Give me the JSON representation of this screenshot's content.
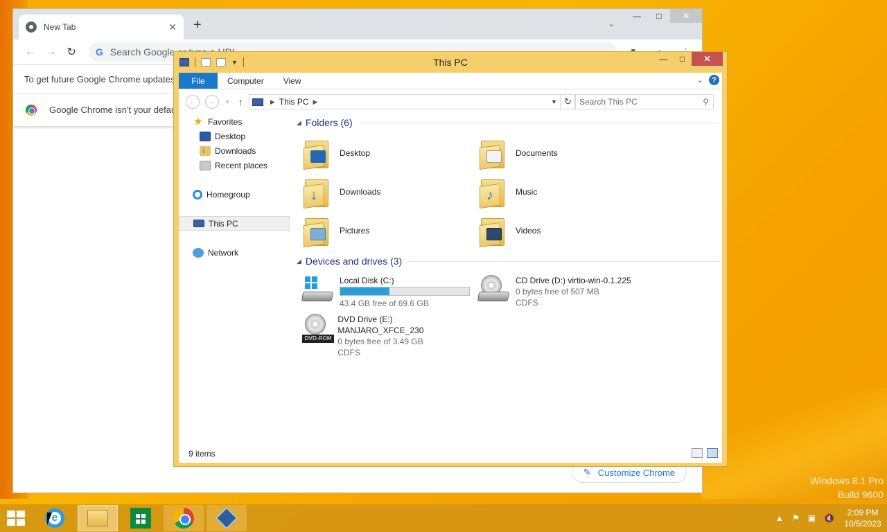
{
  "desktop": {
    "watermark_line1": "Windows 8.1 Pro",
    "watermark_line2": "Build 9600"
  },
  "chrome": {
    "tab_title": "New Tab",
    "tab_close": "✕",
    "new_tab": "+",
    "tab_dropdown": "⌄",
    "controls": {
      "minimize": "—",
      "maximize": "□",
      "close": "✕"
    },
    "nav": {
      "back": "←",
      "forward": "→",
      "reload": "↻"
    },
    "omnibox_placeholder": "Search Google or type a URL",
    "infobar_text": "To get future Google Chrome updates",
    "default_browser_text": "Google Chrome isn't your defau",
    "customize_label": "Customize Chrome",
    "customize_icon": "✎"
  },
  "explorer": {
    "title": "This PC",
    "controls": {
      "minimize": "—",
      "maximize": "□",
      "close": "✕"
    },
    "ribbon": {
      "file": "File",
      "computer": "Computer",
      "view": "View",
      "help": "?"
    },
    "address": {
      "location": "This PC",
      "search_placeholder": "Search This PC"
    },
    "nav": {
      "favorites": "Favorites",
      "desktop": "Desktop",
      "downloads": "Downloads",
      "recent": "Recent places",
      "homegroup": "Homegroup",
      "thispc": "This PC",
      "network": "Network"
    },
    "folders_header": "Folders (6)",
    "folders": [
      {
        "name": "Desktop",
        "icon": "desktop-folder-icon"
      },
      {
        "name": "Documents",
        "icon": "documents-folder-icon"
      },
      {
        "name": "Downloads",
        "icon": "downloads-folder-icon"
      },
      {
        "name": "Music",
        "icon": "music-folder-icon"
      },
      {
        "name": "Pictures",
        "icon": "pictures-folder-icon"
      },
      {
        "name": "Videos",
        "icon": "videos-folder-icon"
      }
    ],
    "drives_header": "Devices and drives (3)",
    "drives": [
      {
        "name": "Local Disk (C:)",
        "free": "43.4 GB free of 69.6 GB",
        "used_fraction": 0.38
      },
      {
        "name": "CD Drive (D:) virtio-win-0.1.225",
        "free": "0 bytes free of 507 MB",
        "fs": "CDFS"
      },
      {
        "name": "DVD Drive (E:) MANJARO_XFCE_230",
        "free": "0 bytes free of 3.49 GB",
        "fs": "CDFS",
        "label": "DVD-ROM"
      }
    ],
    "status": "9 items"
  },
  "taskbar": {
    "clock_time": "2:09 PM",
    "clock_date": "10/5/2023"
  },
  "colors": {
    "desktop": "#f8b400",
    "explorer_frame": "#f5cf6a",
    "file_tab": "#1979ca",
    "close_button": "#c75050",
    "usage_fill": "#26a0da"
  }
}
